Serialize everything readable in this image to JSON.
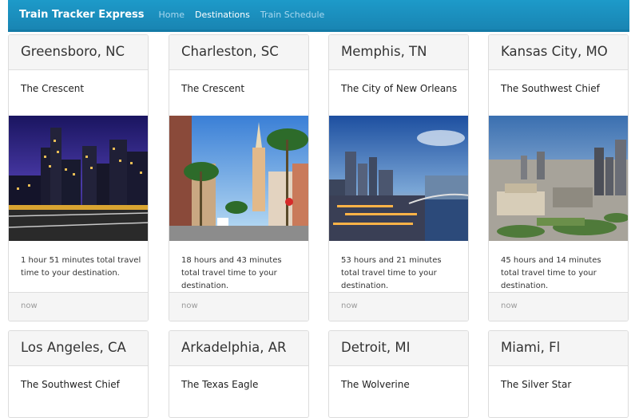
{
  "navbar": {
    "brand": "Train Tracker Express",
    "links": [
      "Home",
      "Destinations",
      "Train Schedule"
    ]
  },
  "cards": [
    {
      "city": "Greensboro, NC",
      "train": "The Crescent",
      "text": "1 hour 51 minutes total travel time to your destination.",
      "footer": "now"
    },
    {
      "city": "Charleston, SC",
      "train": "The Crescent",
      "text": "18 hours and 43 minutes total travel time to your destination.",
      "footer": "now"
    },
    {
      "city": "Memphis, TN",
      "train": "The City of New Orleans",
      "text": "53 hours and 21 minutes total travel time to your destination.",
      "footer": "now"
    },
    {
      "city": "Kansas City, MO",
      "train": "The Southwest Chief",
      "text": "45 hours and 14 minutes total travel time to your destination.",
      "footer": "now"
    },
    {
      "city": "Los Angeles, CA",
      "train": "The Southwest Chief"
    },
    {
      "city": "Arkadelphia, AR",
      "train": "The Texas Eagle"
    },
    {
      "city": "Detroit, MI",
      "train": "The Wolverine"
    },
    {
      "city": "Miami, Fl",
      "train": "The Silver Star"
    }
  ],
  "colors": {
    "navbar": "#1a8fc0",
    "navbar_link_active": "#ffffff",
    "navbar_link": "#a9d8ef"
  }
}
